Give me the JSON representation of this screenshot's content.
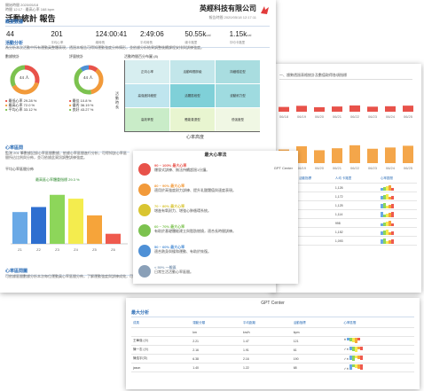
{
  "report": {
    "meta_line1": "開始時間 2020/05/18",
    "meta_line2": "時間 12:17 · 最高心率 168 bpm",
    "title": "活動統計 報告",
    "company": "英經科技有限公司",
    "report_time": "報告時間 2020/05/18 12:17:11",
    "stats_title": "概要數據",
    "stats": [
      {
        "value": "44",
        "label": "人數"
      },
      {
        "value": "201",
        "label": "平均心率"
      },
      {
        "value": "124:00:41",
        "label": "總時長"
      },
      {
        "value": "2:49:06",
        "label": "平均時長"
      },
      {
        "value": "50.55k",
        "unit": "cal",
        "label": "總卡路里"
      },
      {
        "value": "1.15k",
        "unit": "cal",
        "label": "平均卡路里"
      }
    ],
    "activity_title": "活動分析",
    "activity_desc": "為分析本次活動中所有運動員整體表現，透過本報告可得知運動強度分佈情形，並依據分析結果調整後續課程安排與訓練強度。",
    "donut1_title": "數據統計",
    "donut2_title": "評量統計",
    "donut1": {
      "center": "44 人",
      "legend": [
        "最低心率 29.28 %",
        "最高心率 72.0 %",
        "平均心率 33.12 %"
      ]
    },
    "donut2": {
      "center": "44 人",
      "legend": [
        "最佳 10.8 %",
        "優秀 36.19 %",
        "良好 43.27 %"
      ]
    },
    "matrix_title": "活動時間百分布圖 (8)",
    "matrix_cells": [
      "正向心率",
      "活動時間評級",
      "持續穩定型",
      "高強度持續型",
      "活躍區段型",
      "波動耐力型",
      "高效率型",
      "體能衰退型",
      "低強度型"
    ],
    "matrix_xlabel": "心率高度",
    "matrix_ylabel": "活動時長",
    "hr_title": "心率區間",
    "hr_desc": "監測 201 筆數據記錄心率區間數據，依據心率區間進行分析，可得知該心率區間所佔比例與分佈，並可依據此資訊調整訓練強度。",
    "hr_chart_title": "平均心率區間分佈",
    "hr_chart_label": "最高區心率體重指標 29.3 %",
    "hr_footer_title": "心率區間圖",
    "hr_footer_desc": "可依據區間數據分析本次每位運動員心率區間分佈，了解運動強度與訓練成效，可用來調整後續訓練計畫。"
  },
  "chart_data": [
    {
      "type": "bar",
      "title": "平均心率區間分佈",
      "categories": [
        "Z1",
        "Z2",
        "Z3",
        "Z4",
        "Z5",
        "Z6"
      ],
      "values": [
        19,
        22,
        29.3,
        27,
        17,
        6
      ],
      "colors": [
        "#6aa9e6",
        "#2e6fd0",
        "#8dd65a",
        "#f4ec4e",
        "#f6a43a",
        "#ef5a4e"
      ],
      "ylim": [
        0,
        35
      ]
    },
    {
      "type": "bar",
      "title": "",
      "categories": [
        "06/18",
        "06/19",
        "06/20",
        "06/21",
        "06/22",
        "06/23",
        "06/24",
        "06/25"
      ],
      "values": [
        55,
        68,
        52,
        60,
        72,
        58,
        63,
        70
      ],
      "color": "#f4a64a",
      "ylim": [
        0,
        100
      ]
    }
  ],
  "zones": {
    "title": "最大心率法",
    "center_label": "GPT Center",
    "rows": [
      {
        "range": "90 ~ 100% 最大心率",
        "text": "爆發式訓練、無法持續超過1分鐘。",
        "color": "#e8524a"
      },
      {
        "range": "80 ~ 90% 最大心率",
        "text": "適用於高強度耐力訓練、提升乳酸閾值與速度表現。",
        "color": "#f29a3a"
      },
      {
        "range": "70 ~ 80% 最大心率",
        "text": "增進有氧耐力、增強心肺循環系統。",
        "color": "#d9c531"
      },
      {
        "range": "60 ~ 70% 最大心率",
        "text": "有助於基礎體能建立與脂肪燃燒，適合長時間訓練。",
        "color": "#7cc24f"
      },
      {
        "range": "50 ~ 60% 最大心率",
        "text": "適合熱身與緩和運動、有助於恢復。",
        "color": "#4e90d6"
      },
      {
        "range": "< 50% 一般區",
        "text": "日常生活活動心率區間。",
        "color": "#8aa0b8"
      }
    ]
  },
  "page2": {
    "top_text": "一、趨勢透過表格統計及數值取得各項指標",
    "col_headers": [
      "人員",
      "活動指標",
      "人均 卡路里",
      "心率區間"
    ],
    "rows": [
      {
        "a": "115",
        "b": "1,126"
      },
      {
        "a": "115",
        "b": "1,172"
      },
      {
        "a": "115",
        "b": "1,125"
      },
      {
        "a": "115",
        "b": "1,114"
      },
      {
        "a": "110",
        "b": "998"
      },
      {
        "a": "115",
        "b": "1,152"
      },
      {
        "a": "112",
        "b": "1,093"
      }
    ]
  },
  "page3": {
    "header": "GPT Center",
    "section": "最大分析",
    "col_headers": [
      "成員",
      "運動分類",
      "平均距離",
      "活動指標",
      "心率區間"
    ],
    "sub_headers": [
      "",
      "km",
      "km/h",
      "bpm",
      ""
    ],
    "rows": [
      {
        "name": "王華強 (小)",
        "c1": "2.21",
        "c2": "1.47",
        "c3": "121",
        "mark": "✕"
      },
      {
        "name": "陳一志 (小)",
        "c1": "2.16",
        "c2": "1.91",
        "c3": "61",
        "mark": "✓✕"
      },
      {
        "name": "陳浩宇(中)",
        "c1": "6.38",
        "c2": "2.16",
        "c3": "190",
        "mark": "✓✕"
      },
      {
        "name": "jason",
        "c1": "1.40",
        "c2": "1.22",
        "c3": "68",
        "mark": "✓✕"
      }
    ]
  }
}
